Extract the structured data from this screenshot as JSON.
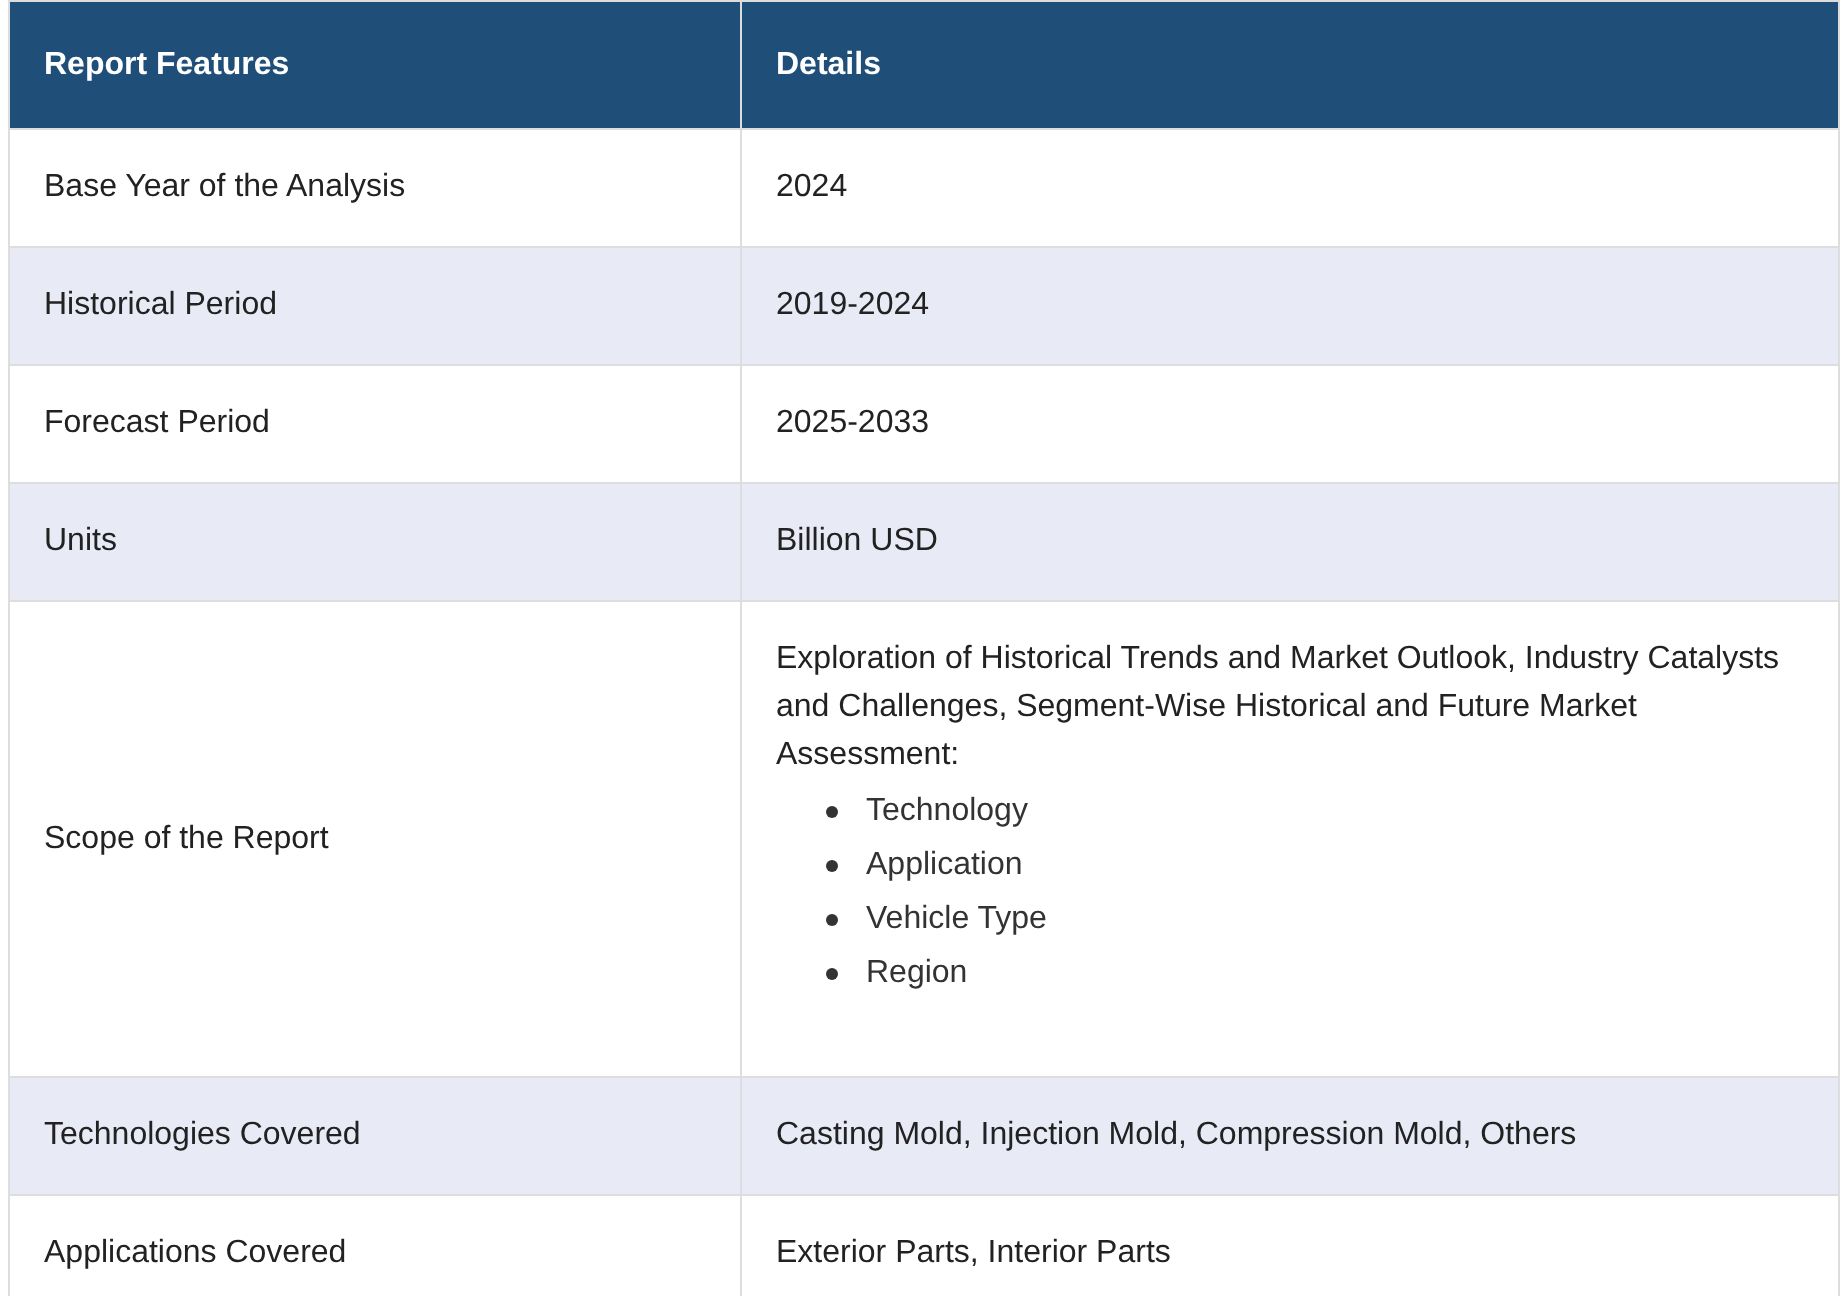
{
  "table": {
    "columns": [
      "Report Features",
      "Details"
    ],
    "rows": [
      {
        "kind": "text",
        "feature": "Base Year of the Analysis",
        "details": "2024"
      },
      {
        "kind": "text",
        "feature": "Historical Period",
        "details": "2019-2024"
      },
      {
        "kind": "text",
        "feature": "Forecast Period",
        "details": "2025-2033"
      },
      {
        "kind": "text",
        "feature": "Units",
        "details": "Billion USD"
      },
      {
        "kind": "list",
        "feature": "Scope of the Report",
        "details": "Exploration of Historical Trends and Market Outlook, Industry Catalysts and Challenges, Segment-Wise Historical and Future Market Assessment:",
        "items": [
          "Technology",
          "Application",
          "Vehicle Type",
          "Region"
        ]
      },
      {
        "kind": "text",
        "feature": "Technologies Covered",
        "details": "Casting Mold, Injection Mold, Compression Mold, Others"
      },
      {
        "kind": "text",
        "feature": "Applications Covered",
        "details": "Exterior Parts, Interior Parts"
      }
    ]
  }
}
